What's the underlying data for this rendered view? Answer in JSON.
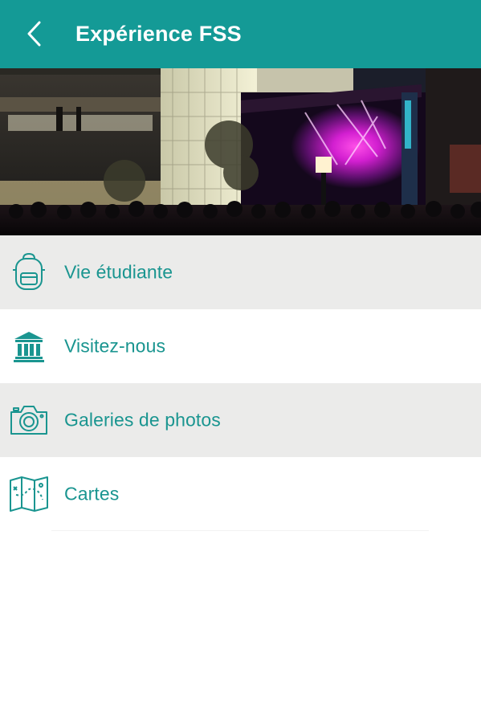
{
  "colors": {
    "primary": "#149a96",
    "accent_text": "#1a9590",
    "row_shade": "#ebebea",
    "header_text": "#ffffff"
  },
  "header": {
    "title": "Expérience FSS",
    "back_icon": "chevron-left-icon"
  },
  "hero": {
    "description_icon": "campus-concert-photo"
  },
  "menu": {
    "items": [
      {
        "label": "Vie étudiante",
        "icon": "backpack-icon",
        "shaded": true
      },
      {
        "label": "Visitez-nous",
        "icon": "building-columns-icon",
        "shaded": false
      },
      {
        "label": "Galeries de photos",
        "icon": "camera-icon",
        "shaded": true
      },
      {
        "label": "Cartes",
        "icon": "map-icon",
        "shaded": false
      }
    ]
  }
}
